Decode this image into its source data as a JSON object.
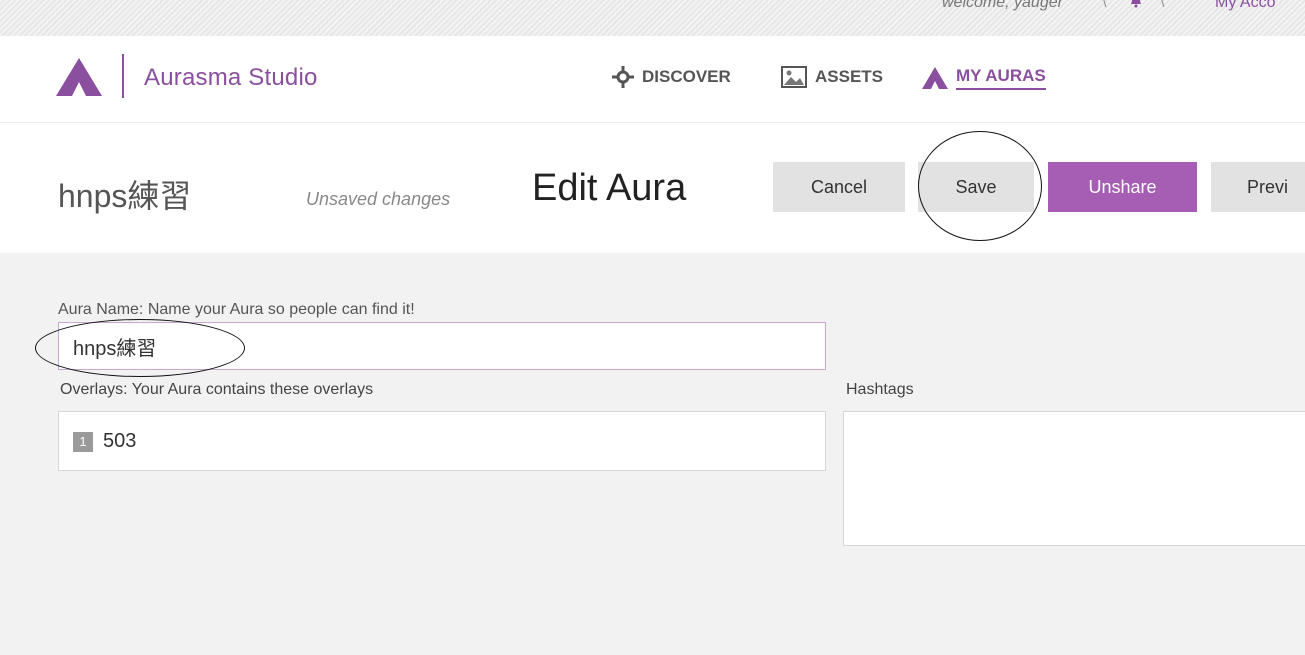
{
  "topbar": {
    "welcome": "welcome, yauger",
    "separator": "\\",
    "account_label": "My Acco"
  },
  "header": {
    "brand": "Aurasma Studio",
    "nav": [
      {
        "label": "DISCOVER",
        "icon": "discover-icon"
      },
      {
        "label": "ASSETS",
        "icon": "image-icon"
      },
      {
        "label": "MY AURAS",
        "icon": "aura-logo-icon",
        "active": true
      }
    ]
  },
  "titlebar": {
    "aura_title": "hnps練習",
    "status": "Unsaved changes",
    "heading": "Edit Aura",
    "buttons": {
      "cancel": "Cancel",
      "save": "Save",
      "unshare": "Unshare",
      "preview": "Previ"
    }
  },
  "form": {
    "name_label": "Aura Name: Name your Aura so people can find it!",
    "name_value": "hnps練習",
    "overlays_label": "Overlays: Your Aura contains these overlays",
    "overlays": [
      {
        "index": "1",
        "name": "503"
      }
    ],
    "hashtags_label": "Hashtags",
    "hashtags_value": ""
  },
  "colors": {
    "brand": "#8a4f9e",
    "unshare_button": "#a55eb3",
    "neutral_button": "#e2e2e2",
    "content_bg": "#f2f2f2"
  }
}
